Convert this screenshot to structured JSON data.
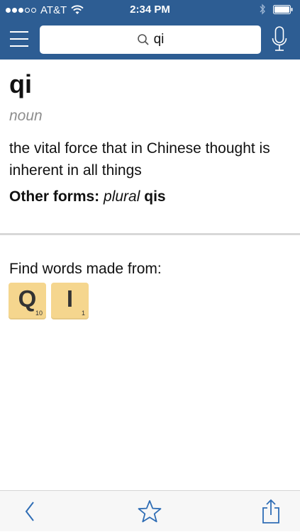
{
  "colors": {
    "brand": "#2d5d93",
    "accent": "#2f6db5",
    "tile": "#f5d68e",
    "muted_text": "#8e8e8e"
  },
  "status_bar": {
    "carrier": "AT&T",
    "time": "2:34 PM",
    "icons": [
      "signal-dots",
      "wifi-icon",
      "bluetooth-icon",
      "battery-icon"
    ]
  },
  "search": {
    "query": "qi",
    "icons": [
      "menu-icon",
      "search-icon",
      "microphone-icon"
    ]
  },
  "entry": {
    "word": "qi",
    "part_of_speech": "noun",
    "definition": "the vital force that in Chinese thought is inherent in all things",
    "other_forms": {
      "label": "Other forms:",
      "plural_label": "plural",
      "form": "qis"
    }
  },
  "find_words": {
    "label": "Find words made from:",
    "tiles": [
      {
        "letter": "Q",
        "score": "10"
      },
      {
        "letter": "I",
        "score": "1"
      }
    ]
  },
  "toolbar": {
    "icons": [
      "back-icon",
      "star-icon",
      "share-icon"
    ]
  }
}
